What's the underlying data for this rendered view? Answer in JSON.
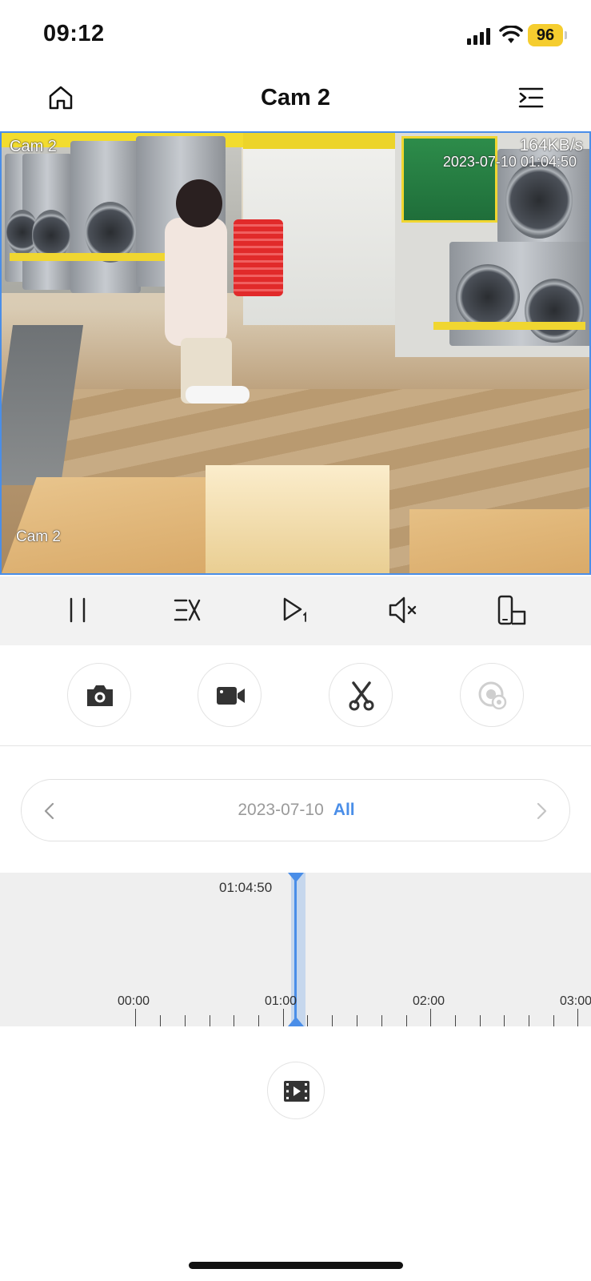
{
  "status_bar": {
    "time": "09:12",
    "battery": "96",
    "battery_color": "#f5cd2f",
    "icons": [
      "cellular-signal-icon",
      "wifi-icon",
      "battery-icon"
    ]
  },
  "nav": {
    "title": "Cam 2",
    "left_icon": "home-icon",
    "right_icon": "device-list-icon"
  },
  "video": {
    "camera_name_top": "Cam 2",
    "bitrate": "164KB/s",
    "timestamp": "2023-07-10 01:04:50",
    "camera_name_bottom": "Cam 2",
    "border_color": "#4a8ee8"
  },
  "controls": [
    {
      "name": "pause-icon"
    },
    {
      "name": "speed-icon"
    },
    {
      "name": "frame-step-icon"
    },
    {
      "name": "mute-icon"
    },
    {
      "name": "orientation-icon"
    }
  ],
  "actions": [
    {
      "name": "snapshot-icon"
    },
    {
      "name": "record-icon"
    },
    {
      "name": "clip-icon"
    },
    {
      "name": "remote-view-icon"
    }
  ],
  "date_selector": {
    "date": "2023-07-10",
    "filter": "All",
    "accent": "#4a8ee8"
  },
  "timeline": {
    "current_time": "01:04:50",
    "tick_labels": [
      "00:00",
      "01:00",
      "02:00",
      "03:00"
    ],
    "cursor_color": "#4a8ee8"
  },
  "bottom_action": {
    "name": "video-clip-list-icon"
  }
}
